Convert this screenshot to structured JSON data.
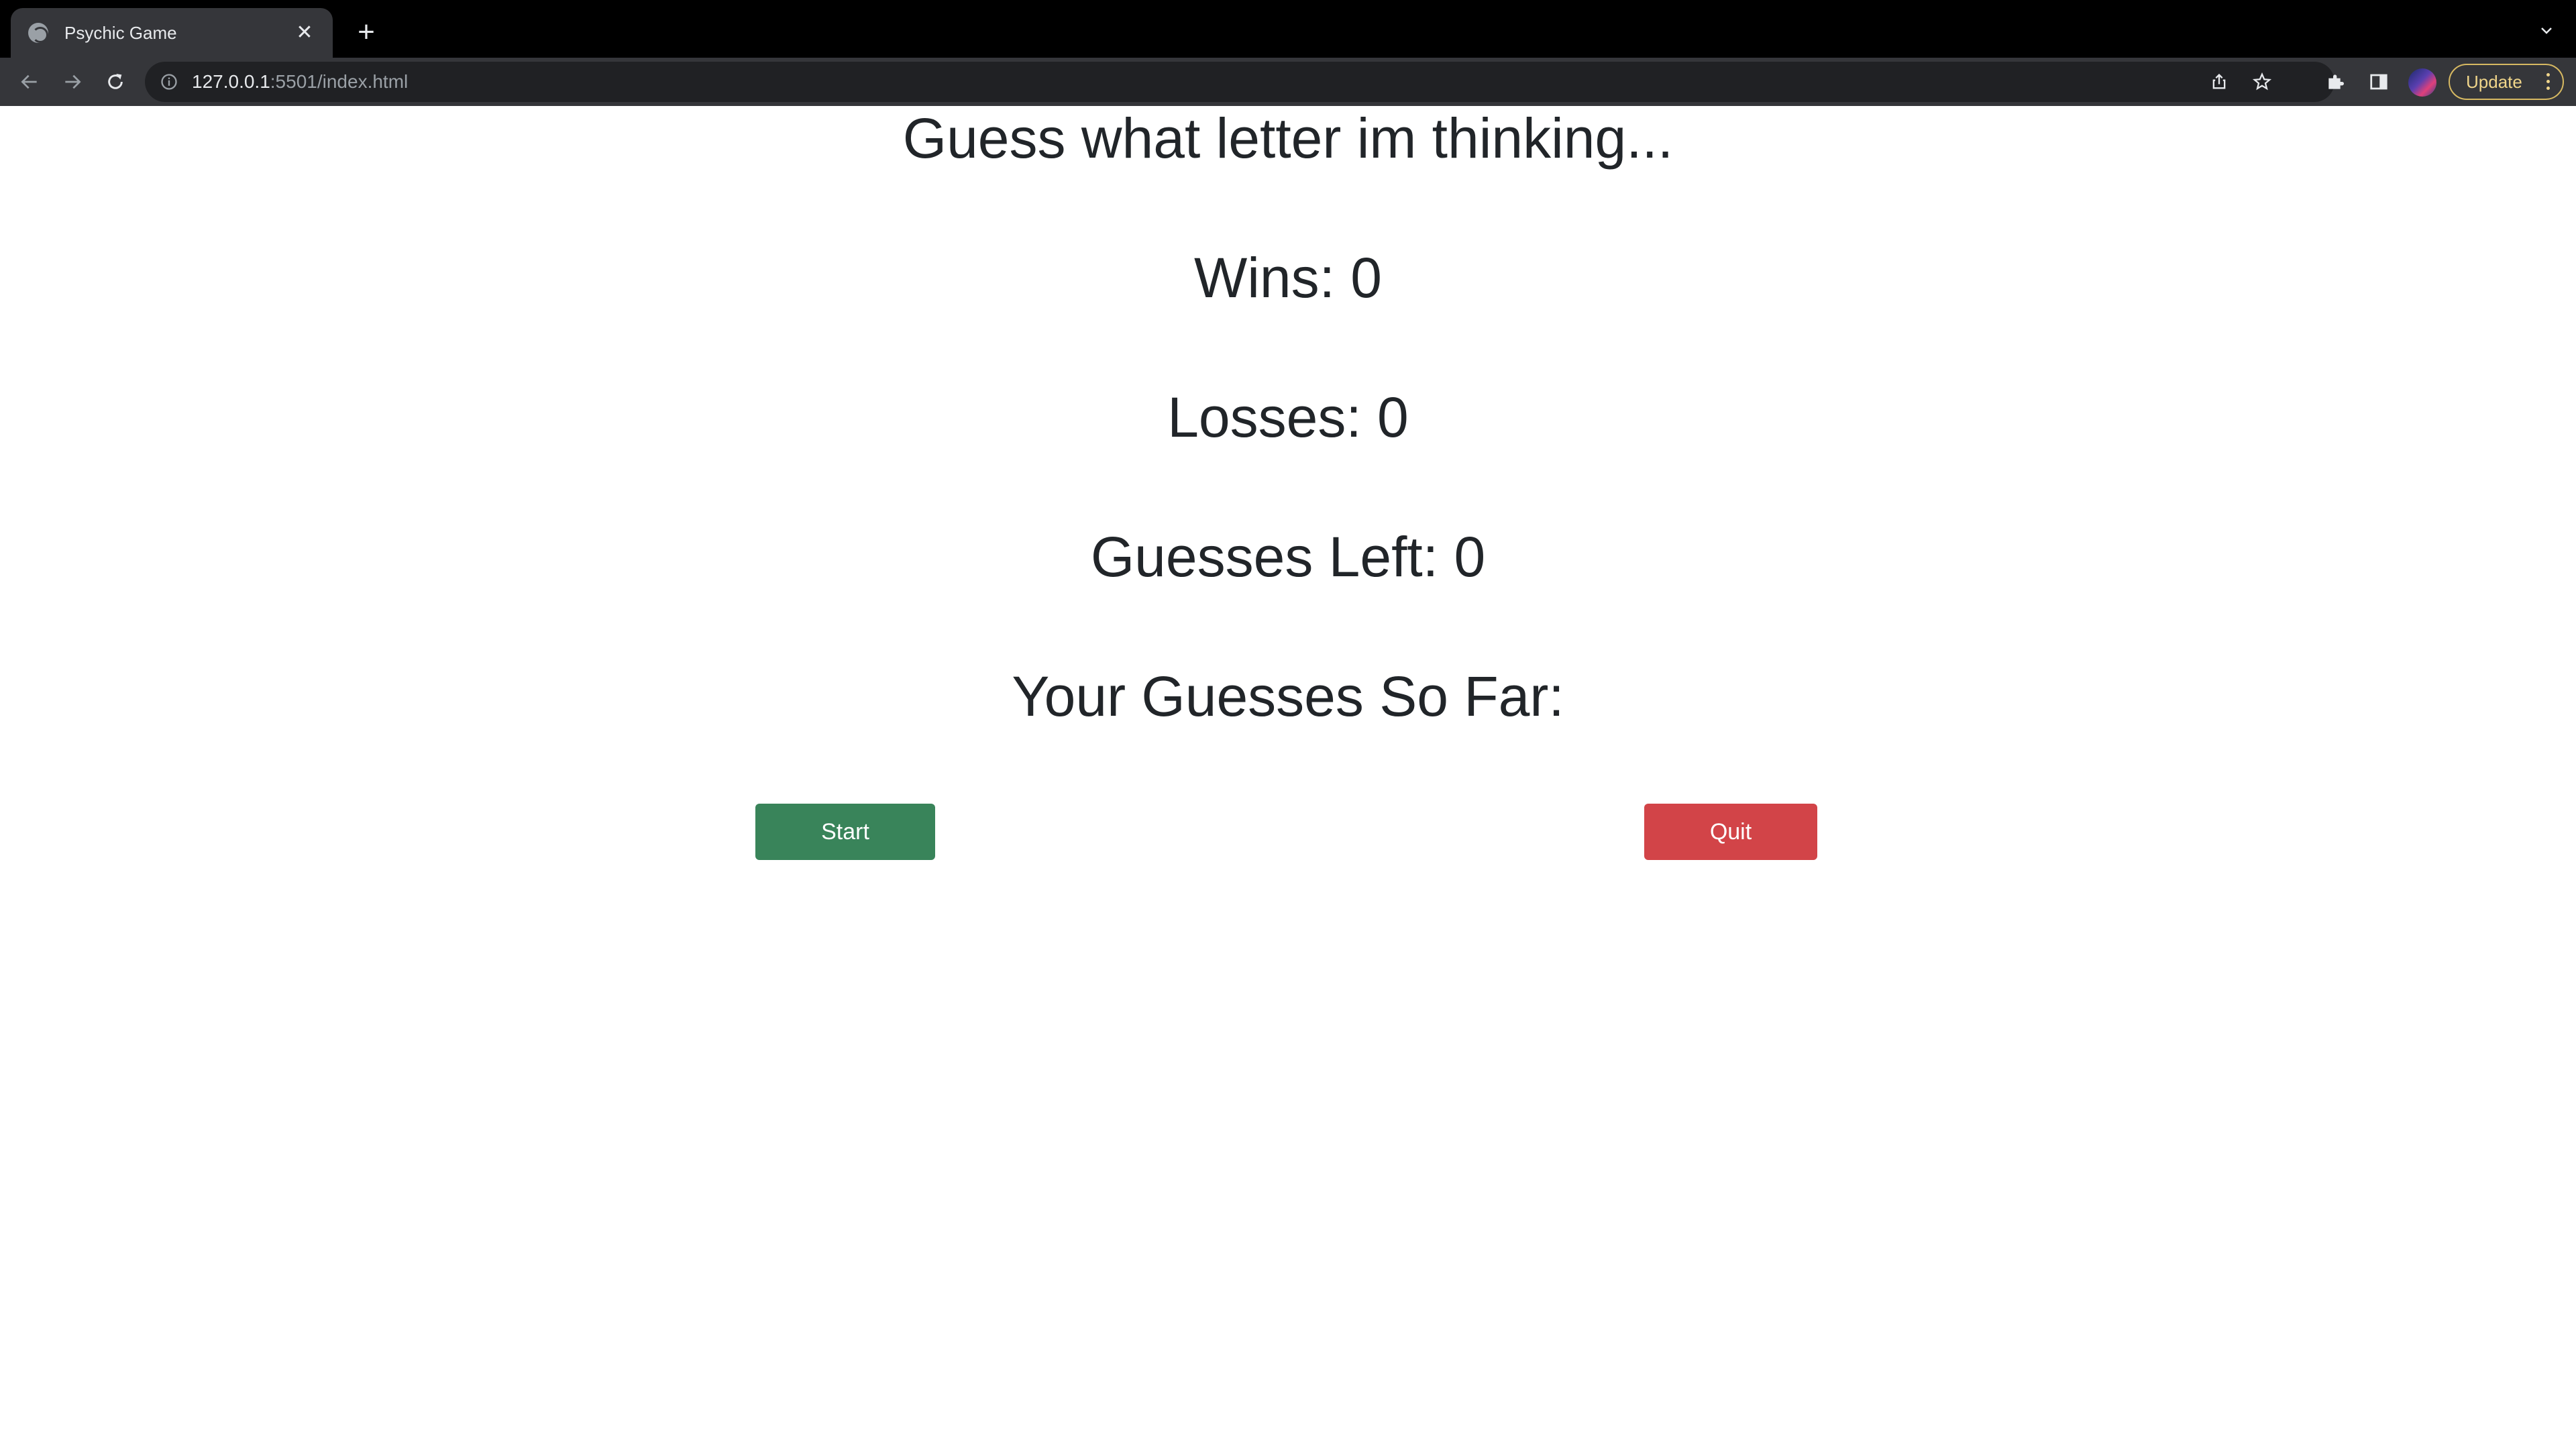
{
  "browser": {
    "tab": {
      "title": "Psychic Game",
      "close_icon": "close-icon",
      "favicon": "globe-icon"
    },
    "new_tab_label": "+",
    "url_host": "127.0.0.1",
    "url_rest": ":5501/index.html",
    "update_label": "Update"
  },
  "page": {
    "heading": "Guess what letter im thinking...",
    "wins": "Wins: 0",
    "losses": "Losses: 0",
    "guesses_left": "Guesses Left: 0",
    "guesses_so_far": "Your Guesses So Far:",
    "start_label": "Start",
    "quit_label": "Quit"
  },
  "colors": {
    "start_button": "#39845a",
    "quit_button": "#d24448",
    "text": "#212529"
  }
}
